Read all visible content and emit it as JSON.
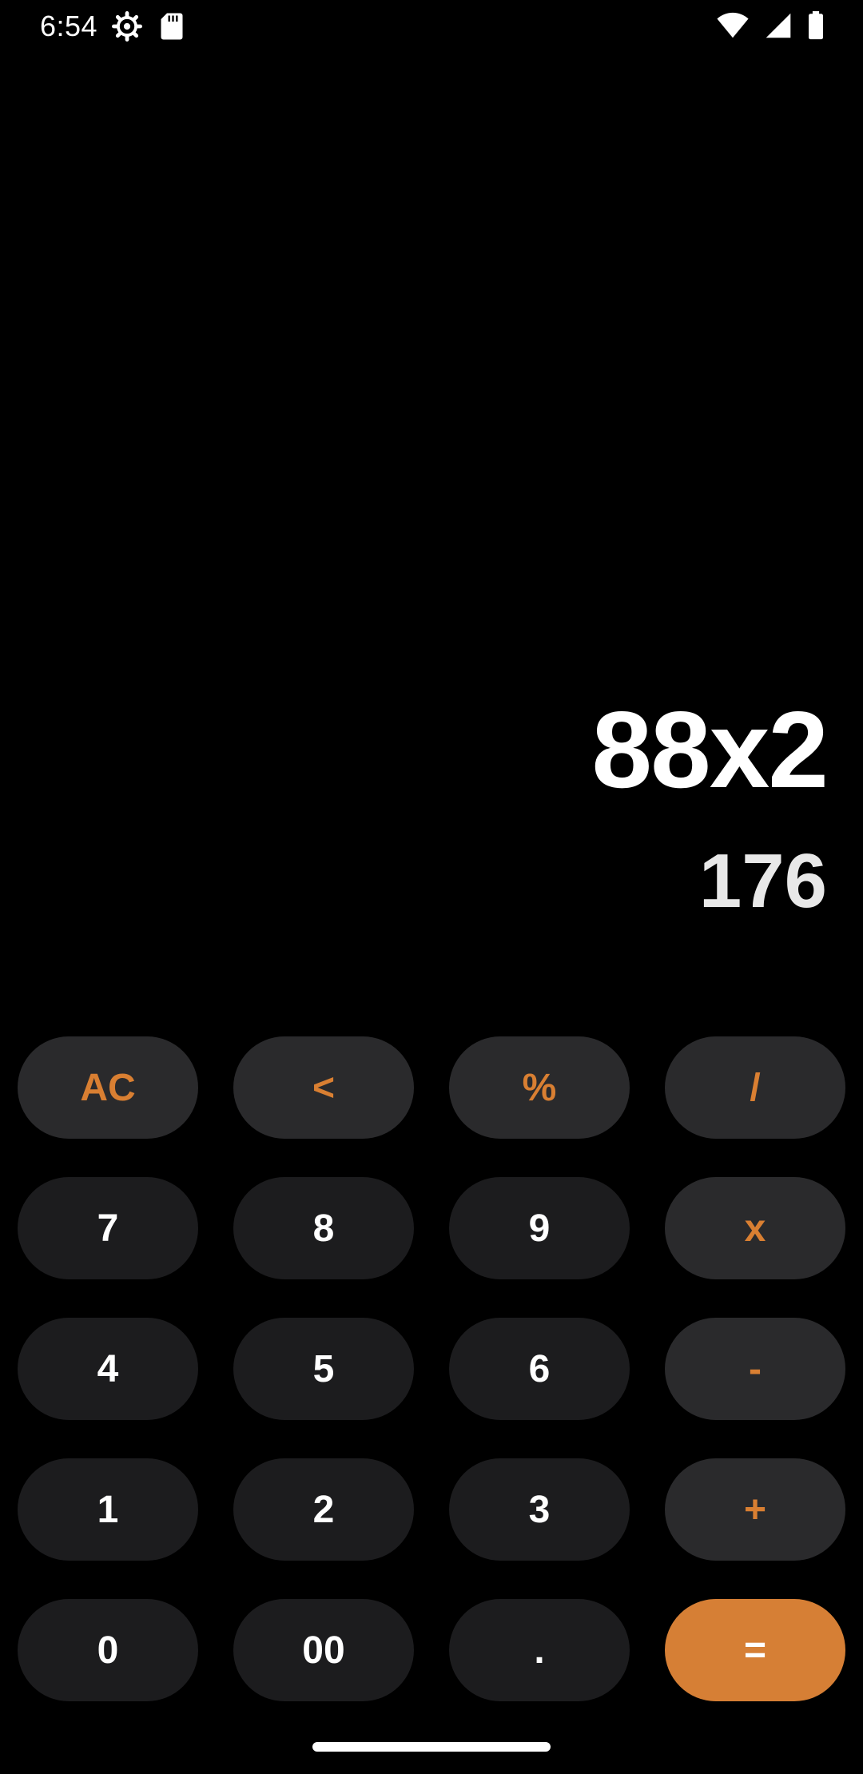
{
  "status_bar": {
    "time": "6:54",
    "left_icons": [
      "settings-icon",
      "sd-card-icon"
    ],
    "right_icons": [
      "wifi-icon",
      "cellular-signal-icon",
      "battery-icon"
    ]
  },
  "display": {
    "expression": "88x2",
    "result": "176"
  },
  "keypad": {
    "rows": [
      [
        {
          "label": "AC",
          "kind": "func"
        },
        {
          "label": "<",
          "kind": "func"
        },
        {
          "label": "%",
          "kind": "func"
        },
        {
          "label": "/",
          "kind": "op"
        }
      ],
      [
        {
          "label": "7",
          "kind": "digit"
        },
        {
          "label": "8",
          "kind": "digit"
        },
        {
          "label": "9",
          "kind": "digit"
        },
        {
          "label": "x",
          "kind": "op"
        }
      ],
      [
        {
          "label": "4",
          "kind": "digit"
        },
        {
          "label": "5",
          "kind": "digit"
        },
        {
          "label": "6",
          "kind": "digit"
        },
        {
          "label": "-",
          "kind": "op"
        }
      ],
      [
        {
          "label": "1",
          "kind": "digit"
        },
        {
          "label": "2",
          "kind": "digit"
        },
        {
          "label": "3",
          "kind": "digit"
        },
        {
          "label": "+",
          "kind": "op"
        }
      ],
      [
        {
          "label": "0",
          "kind": "digit"
        },
        {
          "label": "00",
          "kind": "digit"
        },
        {
          "label": ".",
          "kind": "digit"
        },
        {
          "label": "=",
          "kind": "equals"
        }
      ]
    ]
  },
  "colors": {
    "background": "#000000",
    "key_background": "#1c1c1e",
    "operator_key_background": "#2a2a2c",
    "accent": "#d67f35",
    "text": "#ffffff"
  }
}
